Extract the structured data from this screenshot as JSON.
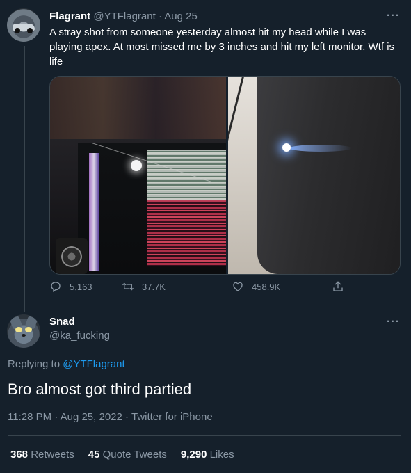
{
  "original_tweet": {
    "display_name": "Flagrant",
    "handle": "@YTFlagrant",
    "separator": "·",
    "date": "Aug 25",
    "text": "A stray shot from someone yesterday almost hit my head while I was playing apex. At most missed me by 3 inches and hit my left monitor. Wtf is life",
    "more_icon": "more-horizontal-icon",
    "replies": "5,163",
    "retweets": "37.7K",
    "likes": "458.9K",
    "icons": [
      "reply-icon",
      "retweet-icon",
      "like-icon",
      "share-icon"
    ]
  },
  "reply_tweet": {
    "display_name": "Snad",
    "handle": "@ka_fucking",
    "replying_prefix": "Replying to",
    "replying_to": "@YTFlagrant",
    "text": "Bro almost got third partied",
    "time": "11:28 PM",
    "date": "Aug 25, 2022",
    "source": "Twitter for iPhone",
    "separator": "·",
    "more_icon": "more-horizontal-icon"
  },
  "stats": {
    "retweets_count": "368",
    "retweets_label": "Retweets",
    "quote_count": "45",
    "quote_label": "Quote Tweets",
    "likes_count": "9,290",
    "likes_label": "Likes"
  },
  "colors": {
    "background": "#15202b",
    "text_primary": "#ffffff",
    "text_secondary": "#8b98a5",
    "accent": "#1d9bf0",
    "border": "#38444d"
  }
}
